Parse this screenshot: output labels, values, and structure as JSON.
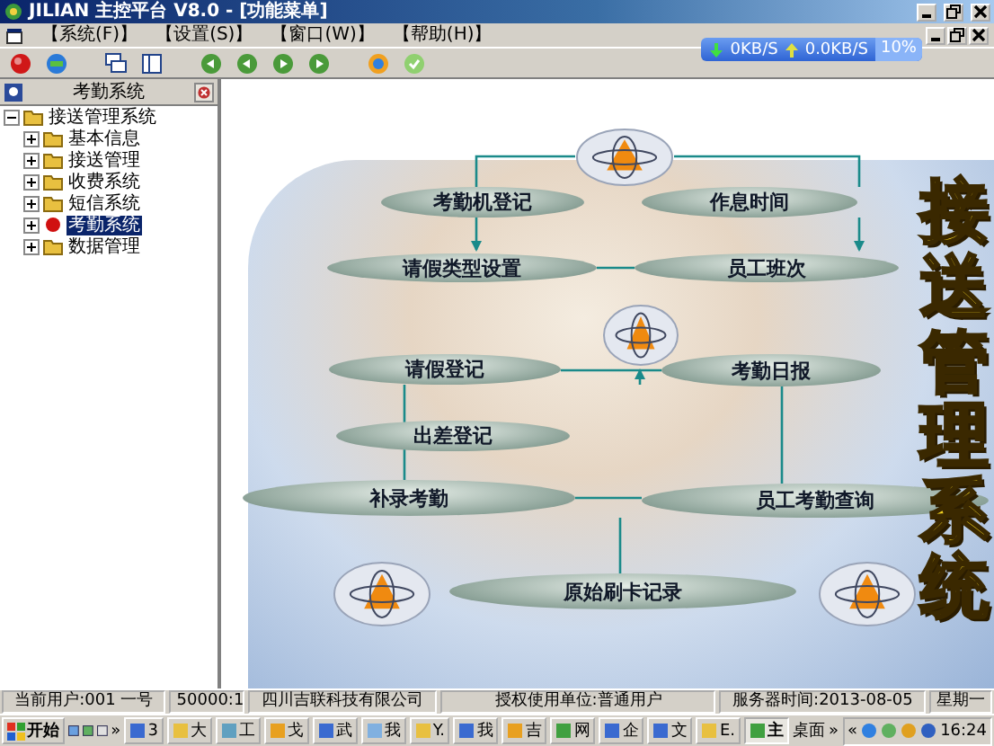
{
  "window": {
    "title": "JILIAN 主控平台 V8.0 - [功能菜单]"
  },
  "menu": [
    {
      "label": "【系统(F)】"
    },
    {
      "label": "【设置(S)】"
    },
    {
      "label": "【窗口(W)】"
    },
    {
      "label": "【帮助(H)】"
    }
  ],
  "network": {
    "download": "0KB/S",
    "upload": "0.0KB/S",
    "usage": "10%"
  },
  "sidebar": {
    "title": "考勤系统",
    "tree": [
      {
        "label": "接送管理系统",
        "expanded": true,
        "selected": false,
        "children": [
          {
            "label": "基本信息",
            "expanded": false,
            "selected": false
          },
          {
            "label": "接送管理",
            "expanded": false,
            "selected": false
          },
          {
            "label": "收费系统",
            "expanded": false,
            "selected": false
          },
          {
            "label": "短信系统",
            "expanded": false,
            "selected": false
          },
          {
            "label": "考勤系统",
            "expanded": false,
            "selected": true
          },
          {
            "label": "数据管理",
            "expanded": false,
            "selected": false
          }
        ]
      }
    ]
  },
  "diagram": {
    "banner": "接送管理系统",
    "nodes": [
      {
        "label": "考勤机登记"
      },
      {
        "label": "作息时间"
      },
      {
        "label": "请假类型设置"
      },
      {
        "label": "员工班次"
      },
      {
        "label": "请假登记"
      },
      {
        "label": "考勤日报"
      },
      {
        "label": "出差登记"
      },
      {
        "label": "补录考勤"
      },
      {
        "label": "员工考勤查询"
      },
      {
        "label": "原始刷卡记录"
      }
    ]
  },
  "status_bar": [
    "当前用户:001  一号",
    "50000:1",
    "四川吉联科技有限公司",
    "授权使用单位:普通用户",
    "服务器时间:2013-08-05",
    "星期一"
  ],
  "taskbar": {
    "start": "开始",
    "quick_more": "»",
    "buttons": [
      {
        "label": "3",
        "selected": false
      },
      {
        "label": "大",
        "selected": false
      },
      {
        "label": "工",
        "selected": false
      },
      {
        "label": "戈",
        "selected": false
      },
      {
        "label": "武",
        "selected": false
      },
      {
        "label": "我",
        "selected": false
      },
      {
        "label": "Y.",
        "selected": false
      },
      {
        "label": "我",
        "selected": false
      },
      {
        "label": "吉",
        "selected": false
      },
      {
        "label": "网",
        "selected": false
      },
      {
        "label": "企",
        "selected": false
      },
      {
        "label": "文",
        "selected": false
      },
      {
        "label": "E.",
        "selected": false
      },
      {
        "label": "主",
        "selected": true
      }
    ],
    "desktop": "桌面",
    "desktop_more": "»",
    "tray_toggle": "«",
    "clock": "16:24"
  }
}
